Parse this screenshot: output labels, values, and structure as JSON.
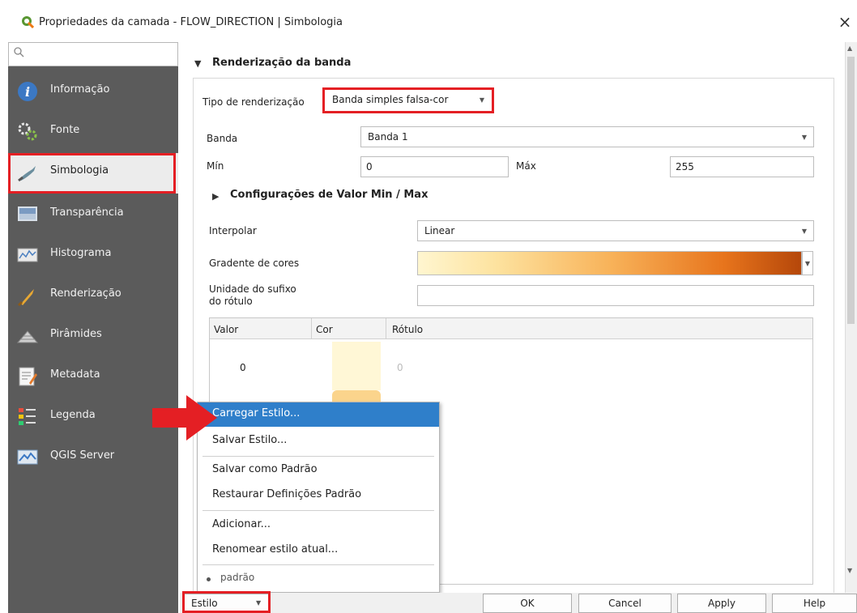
{
  "window": {
    "title": "Propriedades da camada - FLOW_DIRECTION | Simbologia",
    "close_glyph": "×"
  },
  "sidebar": {
    "search_placeholder": "",
    "selected_index": 2,
    "items": [
      {
        "label": "Informação",
        "icon": "info-icon"
      },
      {
        "label": "Fonte",
        "icon": "source-icon"
      },
      {
        "label": "Simbologia",
        "icon": "symbology-brush-icon"
      },
      {
        "label": "Transparência",
        "icon": "transparency-icon"
      },
      {
        "label": "Histograma",
        "icon": "histogram-icon"
      },
      {
        "label": "Renderização",
        "icon": "rendering-brush-icon"
      },
      {
        "label": "Pirâmides",
        "icon": "pyramids-icon"
      },
      {
        "label": "Metadata",
        "icon": "metadata-icon"
      },
      {
        "label": "Legenda",
        "icon": "legend-icon"
      },
      {
        "label": "QGIS Server",
        "icon": "qgis-server-icon"
      }
    ]
  },
  "band_rendering": {
    "section_title": "Renderização da banda",
    "render_type_label": "Tipo de renderização",
    "render_type_value": "Banda simples falsa-cor",
    "band_label": "Banda",
    "band_value": "Banda 1",
    "min_label": "Mín",
    "min_value": "0",
    "max_label": "Máx",
    "max_value": "255",
    "minmax_settings_title": "Configurações de Valor Min / Max",
    "interpolate_label": "Interpolar",
    "interpolate_value": "Linear",
    "color_ramp_label": "Gradente de cores",
    "unit_suffix_label_line1": "Unidade do sufixo",
    "unit_suffix_label_line2": "do rótulo",
    "unit_suffix_value": ""
  },
  "table": {
    "columns": [
      "Valor",
      "Cor",
      "Rótulo"
    ],
    "rows": [
      {
        "value": "0",
        "label": "0"
      }
    ]
  },
  "style_menu": {
    "items": [
      {
        "label": "Carregar Estilo...",
        "active": true
      },
      {
        "label": "Salvar Estilo..."
      },
      {
        "label": "Salvar como Padrão"
      },
      {
        "label": "Restaurar Definições Padrão"
      },
      {
        "label": "Adicionar..."
      },
      {
        "label": "Renomear estilo atual..."
      },
      {
        "label": "padrão",
        "radio": true
      }
    ]
  },
  "buttons": {
    "style": "Estilo",
    "ok": "OK",
    "cancel": "Cancel",
    "apply": "Apply",
    "help": "Help"
  },
  "colors": {
    "highlight_outline": "#e41f24",
    "menu_active": "#2f7fca",
    "sidebar_bg": "#5b5b5b"
  }
}
